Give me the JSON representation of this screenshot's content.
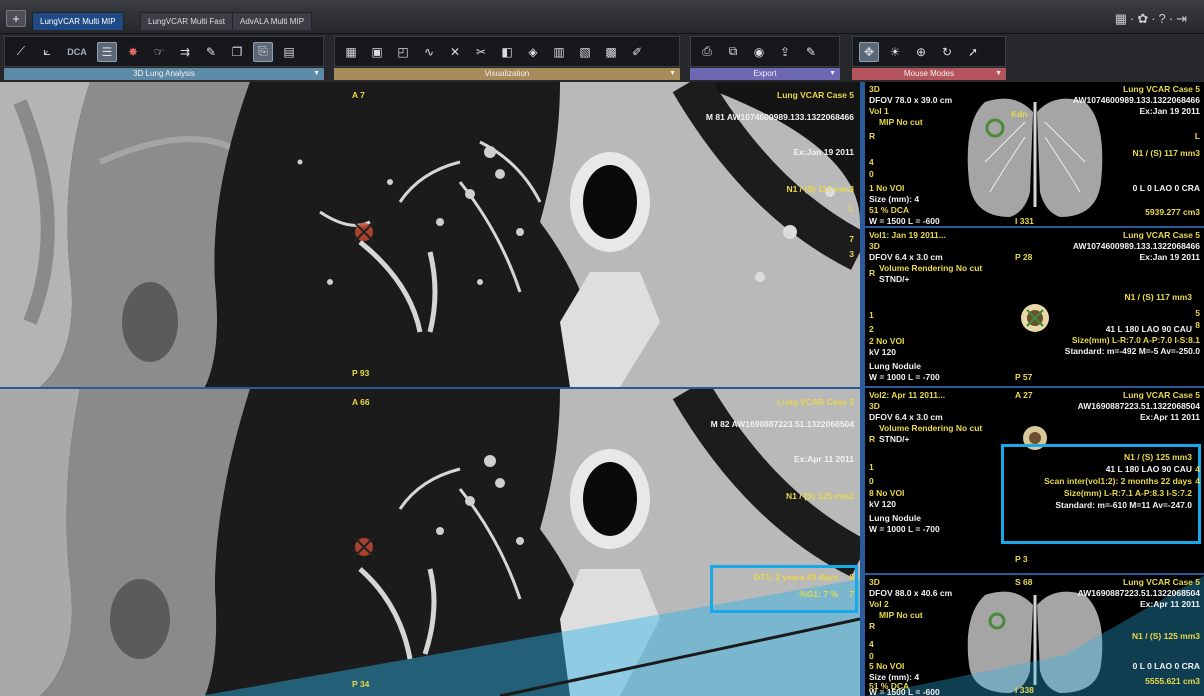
{
  "app": {
    "add_button": "+",
    "tabs": [
      {
        "label": "LungVCAR Multi MIP",
        "active": true
      },
      {
        "label": "LungVCAR Multi Fast",
        "active": false
      },
      {
        "label": "AdvALA Multi MIP",
        "active": false
      }
    ],
    "right_icons": "▦·✿·?·⇥"
  },
  "toolbar": {
    "groups": [
      {
        "label": "3D Lung Analysis",
        "color": "#5d8aa6"
      },
      {
        "label": "Visualization",
        "color": "#a88b5a"
      },
      {
        "label": "Export",
        "color": "#6c68b3"
      },
      {
        "label": "Mouse Modes",
        "color": "#b4545c"
      }
    ],
    "dca_label": "DCA"
  },
  "vp1": {
    "tl": "A 7",
    "tr1": "Lung VCAR Case 5",
    "tr2": "M 81 AW1074600989.133.1322068466",
    "tr3": "Ex:Jan 19 2011",
    "tr4": "N1 / (S) 117 mm3",
    "r_l": "L",
    "r_7": "7",
    "r_3": "3",
    "bottom": "P 93"
  },
  "vp2": {
    "tl": "A 66",
    "tr1": "Lung VCAR Case 5",
    "tr2": "M 82 AW1690887223.51.1322068504",
    "tr3": "Ex:Apr 11 2011",
    "tr4": "N1 / (S) 125 mm3",
    "dt1": "DT1: 2 years 83 days",
    "g1": "%G1: 7 %",
    "r_6": "6",
    "r_7": "7",
    "bottom": "P 34"
  },
  "s1": {
    "l1": "3D",
    "l2": "DFOV 78.0 x 39.0 cm",
    "l3": "Vol 1",
    "l4": "MIP No cut",
    "l5": "R",
    "l6": "4",
    "l7": "0",
    "l8": "1  No VOI",
    "l9": "Size  (mm): 4",
    "l10": "51 % DCA",
    "l11": "W = 1500 L = -600",
    "r1": "Lung VCAR Case 5",
    "r2": "AW1074600989.133.1322068466",
    "r3": "Ex:Jan 19 2011",
    "r4": "L",
    "r5": "N1 / (S) 117 mm3",
    "r6": "0 L 0 LAO 0 CRA",
    "r7": "5939.277 cm3",
    "b": "I 331",
    "tag": "Kdn"
  },
  "s2": {
    "l1": "Vol1: Jan 19 2011...",
    "l2": "3D",
    "l3": "DFOV 6.4 x 3.0 cm",
    "l4": "Volume Rendering No cut",
    "l5": "STND/+",
    "l6": "R",
    "l7": "1",
    "l8": "2",
    "l9": "2  No VOI",
    "l10": "kV 120",
    "l11": "Lung Nodule",
    "l12": "W = 1000 L = -700",
    "r1": "Lung VCAR Case 5",
    "r2": "AW1074600989.133.1322068466",
    "r3": "Ex:Jan 19 2011",
    "p": "P 28",
    "r4": "N1 / (S) 117 mm3",
    "r5": "41 L 180 LAO 90 CAU",
    "r6": "Size(mm) L-R:7.0 A-P:7.0 I-S:8.1",
    "r7": "Standard:  m=-492 M=-5 Av=-250.0",
    "b": "P 57",
    "e5": "5",
    "e8": "8"
  },
  "s3": {
    "l1": "Vol2: Apr 11 2011...",
    "l2": "3D",
    "l3": "DFOV 6.4 x 3.0 cm",
    "l4": "Volume Rendering No cut",
    "l5": "STND/+",
    "l6": "R",
    "l7": "1",
    "l8": "0",
    "l9": "8  No VOI",
    "l10": "kV 120",
    "l11": "Lung Nodule",
    "l12": "W = 1000 L = -700",
    "a": "A 27",
    "r1": "Lung VCAR Case 5",
    "r2": "AW1690887223.51.1322068504",
    "r3": "Ex:Apr 11 2011",
    "r4": "N1 / (S) 125 mm3",
    "r5": "41 L 180 LAO 90 CAU",
    "r6": "Scan inter(vol1:2): 2 months 22 days",
    "r7": "Size(mm) L-R:7.1 A-P:8.3 I-S:7.2",
    "r8": "Standard:  m=-610 M=11 Av=-247.0",
    "b": "P 3",
    "e4a": "4",
    "e4b": "4"
  },
  "s4": {
    "l1": "3D",
    "l2": "DFOV 88.0 x 40.6 cm",
    "l3": "Vol 2",
    "l4": "MIP No cut",
    "l5": "R",
    "l6": "4",
    "l7": "0",
    "l8": "5  No VOI",
    "l9": "Size  (mm): 4",
    "l10": "51 % DCA",
    "l11": "W = 1500 L = -600",
    "s": "S 68",
    "r1": "Lung VCAR Case 5",
    "r2": "AW1690887223.51.1322068504",
    "r3": "Ex:Apr 11 2011",
    "r4": "N1 / (S) 125 mm3",
    "r5": "0 L 0 LAO 0 CRA",
    "r6": "5555.621 cm3",
    "b": "I 338"
  }
}
